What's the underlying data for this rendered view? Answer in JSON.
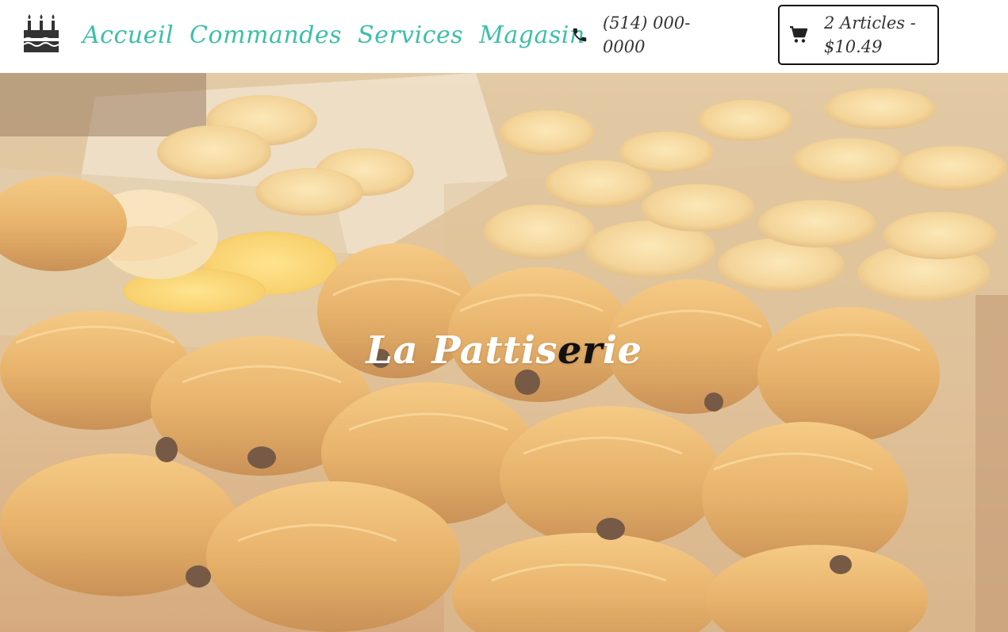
{
  "brand": {
    "logo_icon": "birthday-cake-icon"
  },
  "nav": {
    "items": [
      {
        "label": "Accueil"
      },
      {
        "label": "Commandes"
      },
      {
        "label": "Services"
      },
      {
        "label": "Magasin"
      }
    ],
    "color": "#3dbfa8"
  },
  "contact": {
    "phone_icon": "phone-icon",
    "phone": "(514) 000-0000"
  },
  "cart": {
    "icon": "shopping-cart-icon",
    "summary": "2 Articles - $10.49"
  },
  "hero": {
    "title_part1": "La Pattis",
    "title_part2": "er",
    "title_part3": "ie"
  }
}
